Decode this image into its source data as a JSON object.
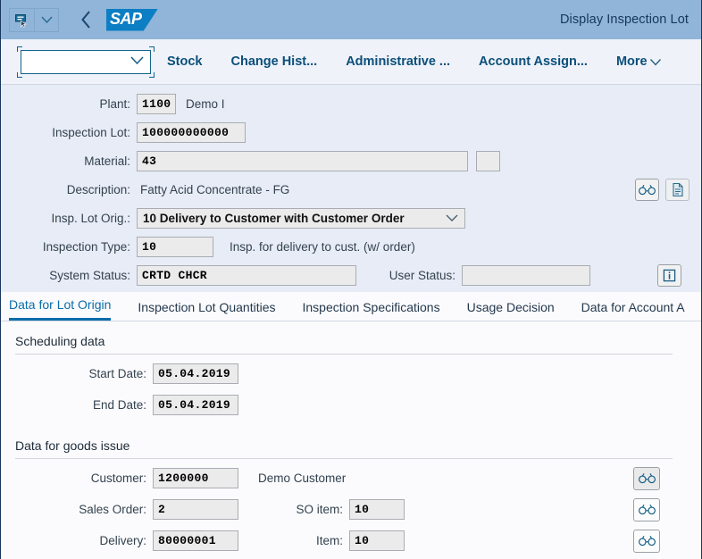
{
  "shell": {
    "title": "Display Inspection Lot",
    "logo_text": "SAP",
    "back_icon": "chevron-left-icon",
    "menu_icon": "message-cursor-icon",
    "dropdown_icon": "chevron-down-icon"
  },
  "toolbar": {
    "combo_value": "",
    "combo_placeholder": "",
    "items": [
      {
        "label": "Stock"
      },
      {
        "label": "Change Hist..."
      },
      {
        "label": "Administrative ..."
      },
      {
        "label": "Account Assign..."
      },
      {
        "label": "More"
      }
    ]
  },
  "form": {
    "plant": {
      "label": "Plant:",
      "value": "1100",
      "desc": "Demo I"
    },
    "inspection_lot": {
      "label": "Inspection Lot:",
      "value": "100000000000"
    },
    "material": {
      "label": "Material:",
      "value": "43"
    },
    "description": {
      "label": "Description:",
      "value": "Fatty Acid Concentrate - FG"
    },
    "lot_origin": {
      "label": "Insp. Lot Orig.:",
      "value": "10 Delivery to Customer with Customer Order"
    },
    "inspection_type": {
      "label": "Inspection Type:",
      "value": "10",
      "desc": "Insp. for delivery to cust. (w/ order)"
    },
    "system_status": {
      "label": "System Status:",
      "value": "CRTD CHCR"
    },
    "user_status": {
      "label": "User Status:",
      "value": ""
    }
  },
  "tabs": [
    {
      "label": "Data for Lot Origin",
      "active": true
    },
    {
      "label": "Inspection Lot Quantities",
      "active": false
    },
    {
      "label": "Inspection Specifications",
      "active": false
    },
    {
      "label": "Usage Decision",
      "active": false
    },
    {
      "label": "Data for Account A",
      "active": false
    }
  ],
  "scheduling": {
    "title": "Scheduling data",
    "start_date": {
      "label": "Start Date:",
      "value": "05.04.2019"
    },
    "end_date": {
      "label": "End Date:",
      "value": "05.04.2019"
    }
  },
  "goods_issue": {
    "title": "Data for goods issue",
    "customer": {
      "label": "Customer:",
      "value": "1200000",
      "desc": "Demo Customer"
    },
    "sales_order": {
      "label": "Sales Order:",
      "value": "2"
    },
    "so_item": {
      "label": "SO item:",
      "value": "10"
    },
    "delivery": {
      "label": "Delivery:",
      "value": "80000001"
    },
    "item": {
      "label": "Item:",
      "value": "10"
    }
  },
  "icons": {
    "binoculars": "binoculars-icon",
    "document": "document-icon",
    "info": "info-icon"
  },
  "colors": {
    "shell_bg": "#90b5d8",
    "toolbar_bg": "#eff2f9",
    "form_bg": "#e8ecf6",
    "content_bg": "#fbfbfd",
    "accent": "#0a6ca8",
    "logo_blue": "#0c7ec4"
  }
}
